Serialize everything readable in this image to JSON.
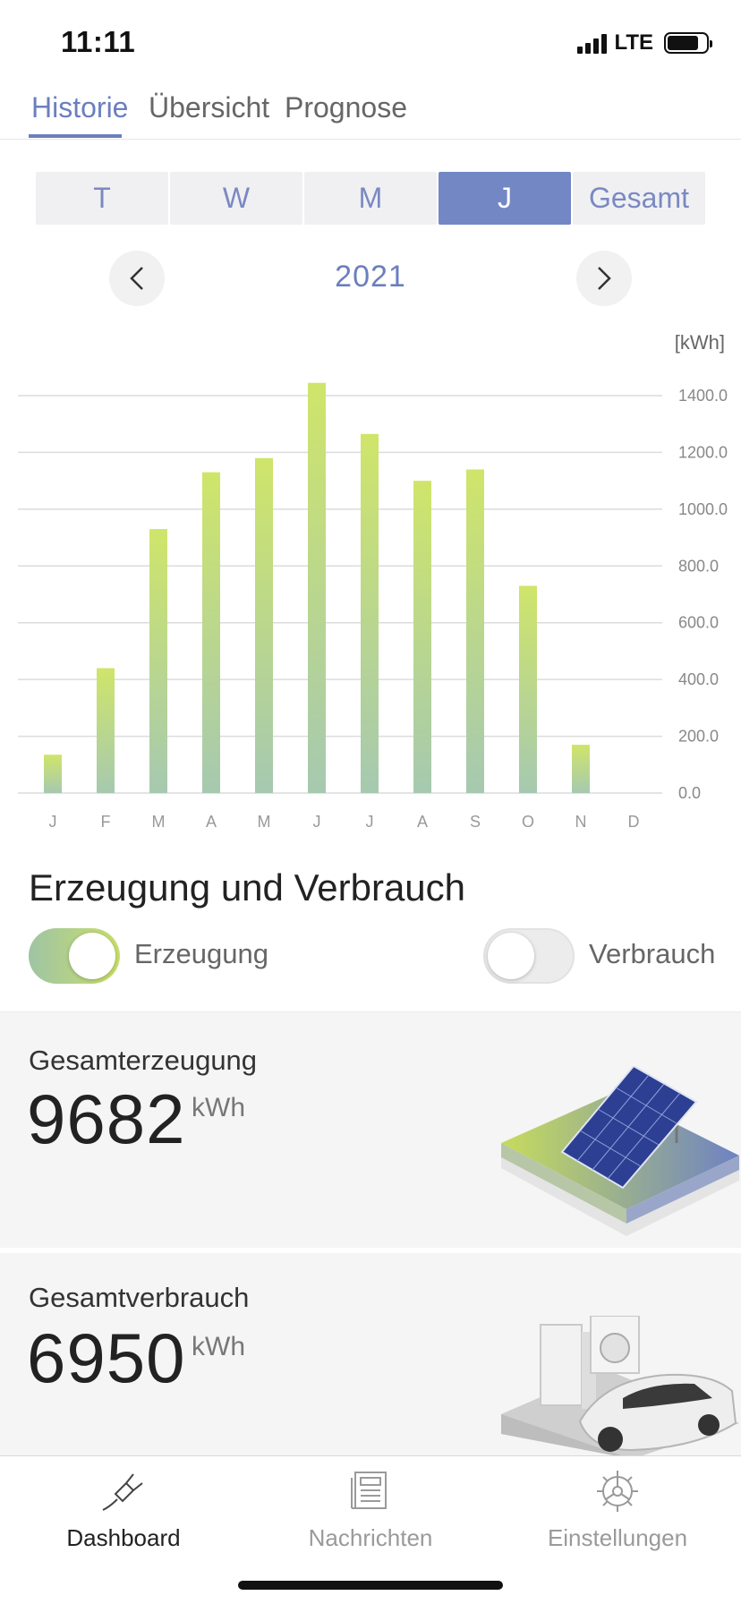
{
  "status_bar": {
    "time": "11:11",
    "network": "LTE"
  },
  "top_tabs": [
    {
      "label": "Historie",
      "active": true
    },
    {
      "label": "Übersicht",
      "active": false
    },
    {
      "label": "Prognose",
      "active": false
    }
  ],
  "period_segments": [
    {
      "label": "T",
      "active": false
    },
    {
      "label": "W",
      "active": false
    },
    {
      "label": "M",
      "active": false
    },
    {
      "label": "J",
      "active": true
    },
    {
      "label": "Gesamt",
      "active": false
    }
  ],
  "year_nav": {
    "year": "2021",
    "prev_icon": "chevron-left-icon",
    "next_icon": "chevron-right-icon"
  },
  "chart_data": {
    "type": "bar",
    "unit_label": "[kWh]",
    "categories": [
      "J",
      "F",
      "M",
      "A",
      "M",
      "J",
      "J",
      "A",
      "S",
      "O",
      "N",
      "D"
    ],
    "series": [
      {
        "values": [
          135,
          440,
          930,
          1130,
          1180,
          1445,
          1265,
          1100,
          1140,
          730,
          170,
          0
        ]
      }
    ],
    "y_ticks": [
      "0.0",
      "200.0",
      "400.0",
      "600.0",
      "800.0",
      "1000.0",
      "1200.0",
      "1400.0"
    ],
    "ylim": [
      0,
      1400
    ],
    "grid": true,
    "bar_gradient": [
      "#cfe56a",
      "#a6c9b0"
    ]
  },
  "section": {
    "title": "Erzeugung und Verbrauch",
    "toggles": [
      {
        "label": "Erzeugung",
        "on": true
      },
      {
        "label": "Verbrauch",
        "on": false
      }
    ]
  },
  "cards": [
    {
      "title": "Gesamterzeugung",
      "value": "9682",
      "unit": "kWh",
      "illustration": "solar-panel-illustration"
    },
    {
      "title": "Gesamtverbrauch",
      "value": "6950",
      "unit": "kWh",
      "illustration": "appliances-car-illustration"
    }
  ],
  "bottom_nav": [
    {
      "label": "Dashboard",
      "icon": "plug-icon",
      "active": true
    },
    {
      "label": "Nachrichten",
      "icon": "newspaper-icon",
      "active": false
    },
    {
      "label": "Einstellungen",
      "icon": "gear-icon",
      "active": false
    }
  ]
}
